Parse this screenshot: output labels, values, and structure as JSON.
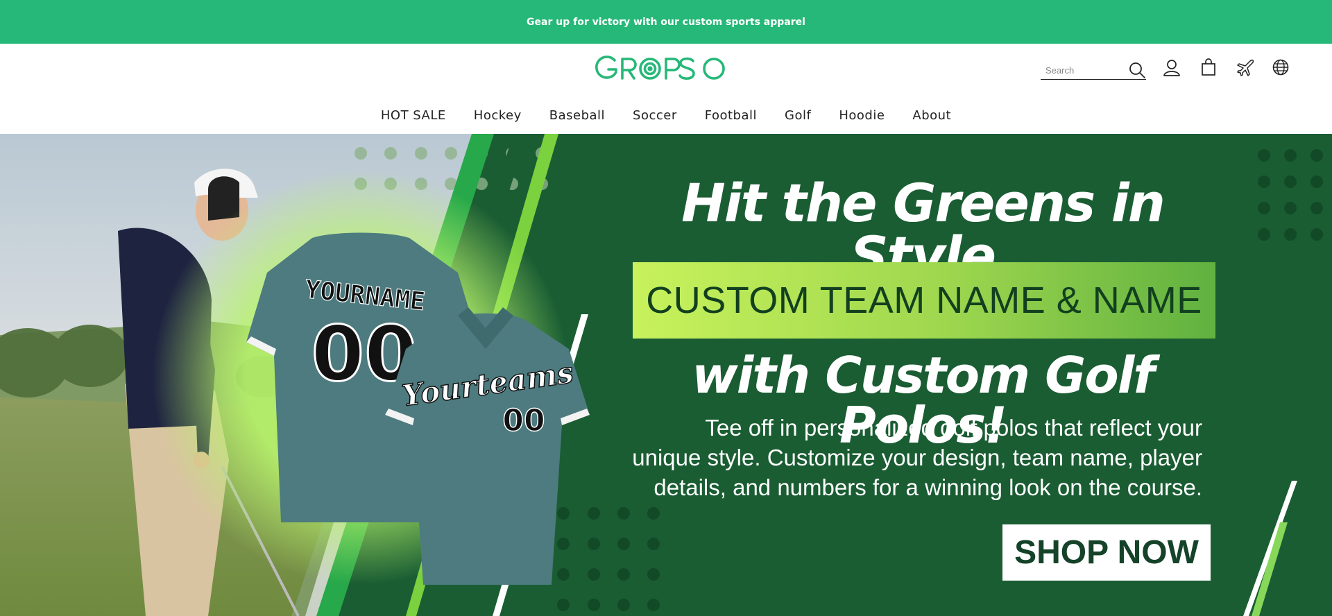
{
  "announcement": {
    "text": "Gear up for victory with our custom sports apparel"
  },
  "brand": {
    "name": "GROPSO",
    "color": "#26b878"
  },
  "search": {
    "placeholder": "Search"
  },
  "header_icons": [
    "search-icon",
    "account-icon",
    "cart-icon",
    "plane-icon",
    "globe-icon"
  ],
  "nav": {
    "items": [
      {
        "label": "HOT SALE"
      },
      {
        "label": "Hockey"
      },
      {
        "label": "Baseball"
      },
      {
        "label": "Soccer"
      },
      {
        "label": "Football"
      },
      {
        "label": "Golf"
      },
      {
        "label": "Hoodie"
      },
      {
        "label": "About"
      }
    ]
  },
  "hero": {
    "headline": "Hit the Greens in Style",
    "banner": "CUSTOM TEAM NAME & NAME",
    "headline2": "with Custom Golf Polos!",
    "body_lines": [
      "Tee off in personalized golf polos that reflect your",
      "unique style. Customize your design, team name, player",
      "details, and numbers for a winning look on the course."
    ],
    "cta": "SHOP NOW",
    "shirt_back_name": "YOURNAME",
    "shirt_back_number": "00",
    "shirt_front_team": "Yourteams",
    "shirt_front_number": "00",
    "colors": {
      "dark_green": "#1a5d33",
      "polo_teal": "#4d7b7f",
      "lime": "#c8f25c"
    }
  }
}
